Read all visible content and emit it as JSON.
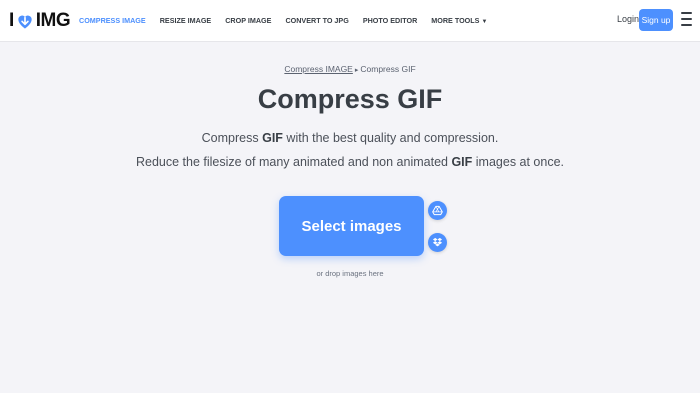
{
  "brand": {
    "logo_left": "I",
    "logo_right": "IMG",
    "accent": "#4d90fe"
  },
  "nav": {
    "items": [
      {
        "label": "COMPRESS IMAGE",
        "active": true
      },
      {
        "label": "RESIZE IMAGE"
      },
      {
        "label": "CROP IMAGE"
      },
      {
        "label": "CONVERT TO JPG"
      },
      {
        "label": "PHOTO EDITOR"
      },
      {
        "label": "MORE TOOLS",
        "has_caret": true
      }
    ],
    "login": "Login",
    "signup": "Sign up"
  },
  "breadcrumb": {
    "parent": "Compress IMAGE",
    "current": "Compress GIF"
  },
  "hero": {
    "title": "Compress GIF",
    "desc1_pre": "Compress ",
    "desc1_bold": "GIF",
    "desc1_post": " with the best quality and compression.",
    "desc2_pre": "Reduce the filesize of many animated and non animated ",
    "desc2_bold": "GIF",
    "desc2_post": " images at once."
  },
  "upload": {
    "select_label": "Select images",
    "drop_hint": "or drop images here",
    "cloud_icons": [
      "google-drive-icon",
      "dropbox-icon"
    ]
  }
}
